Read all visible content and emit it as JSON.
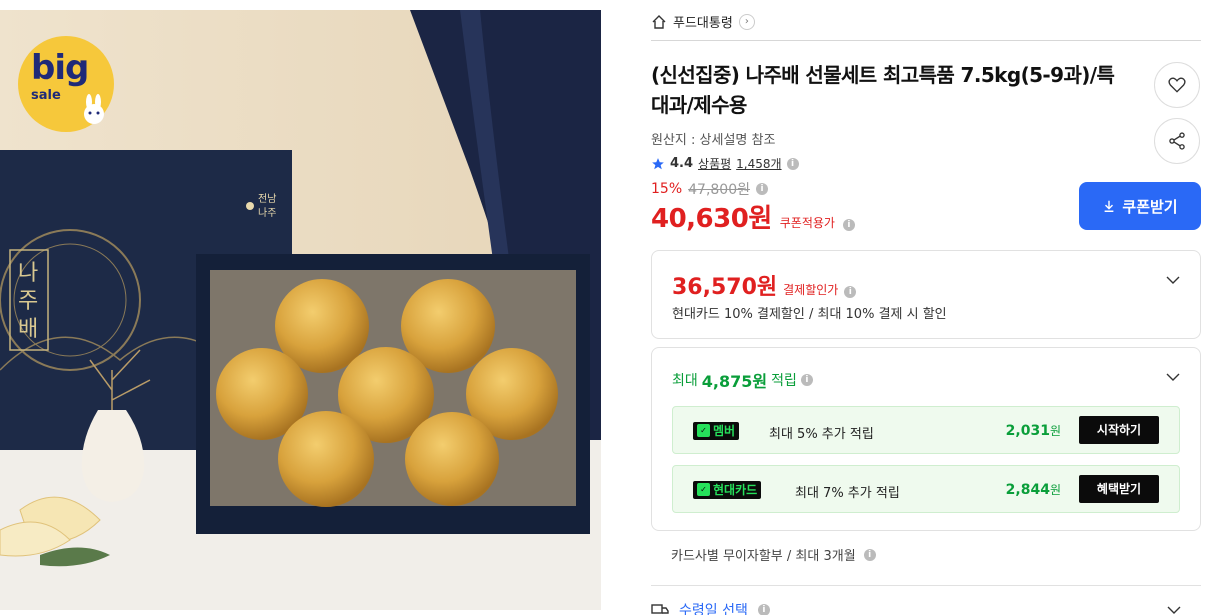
{
  "badge": {
    "big": "big",
    "sale": "sale"
  },
  "store": {
    "name": "푸드대통령"
  },
  "product": {
    "title": "(신선집중) 나주배 선물세트 최고특품 7.5kg(5-9과)/특대과/제수용",
    "origin": "원산지 : 상세설명 참조",
    "rating": "4.4",
    "reviews_label": "상품평",
    "reviews_count": "1,458개",
    "discount_rate": "15%",
    "original_price": "47,800원",
    "price": "40,630원",
    "price_note": "쿠폰적용가",
    "box_text_1": "전남\n나주",
    "box_text_2": "나주배"
  },
  "actions": {
    "coupon_label": "쿠폰받기"
  },
  "payment_discount": {
    "price": "36,570원",
    "label": "결제할인가",
    "desc": "현대카드 10% 결제할인 / 최대 10% 결제 시 할인"
  },
  "rewards": {
    "prefix": "최대",
    "amount": "4,875원",
    "suffix": "적립",
    "items": [
      {
        "tag": "멤버",
        "text": "최대 5% 추가 적립",
        "amount": "2,031",
        "unit": "원",
        "action": "시작하기"
      },
      {
        "tag": "현대카드",
        "text": "최대 7% 추가 적립",
        "amount": "2,844",
        "unit": "원",
        "action": "혜택받기"
      }
    ]
  },
  "installment": "카드사별 무이자할부 / 최대 3개월",
  "delivery": {
    "label": "수령일 선택"
  },
  "colors": {
    "price_red": "#e02020",
    "accent_blue": "#2a69f6",
    "reward_green": "#0a9e3a",
    "tag_green": "#26e05b"
  }
}
